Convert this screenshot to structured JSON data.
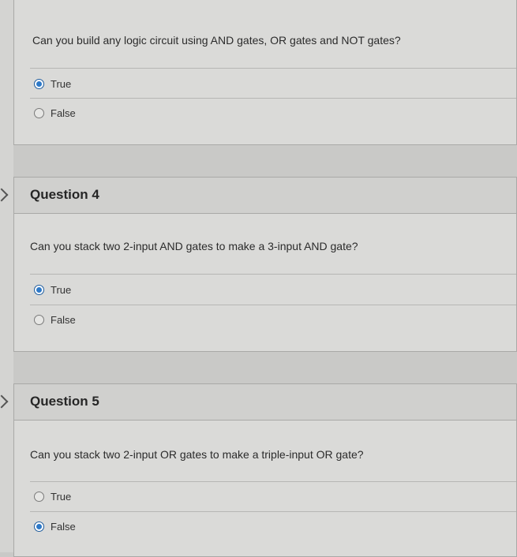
{
  "questions": [
    {
      "title": "",
      "text": "Can you build any logic circuit using AND gates, OR gates and NOT gates?",
      "options": [
        {
          "label": "True",
          "selected": true
        },
        {
          "label": "False",
          "selected": false
        }
      ]
    },
    {
      "title": "Question 4",
      "text": "Can you stack two 2-input AND gates to make a 3-input AND gate?",
      "options": [
        {
          "label": "True",
          "selected": true
        },
        {
          "label": "False",
          "selected": false
        }
      ]
    },
    {
      "title": "Question 5",
      "text": "Can you stack two 2-input OR gates to make a triple-input OR gate?",
      "options": [
        {
          "label": "True",
          "selected": false
        },
        {
          "label": "False",
          "selected": true
        }
      ]
    }
  ]
}
